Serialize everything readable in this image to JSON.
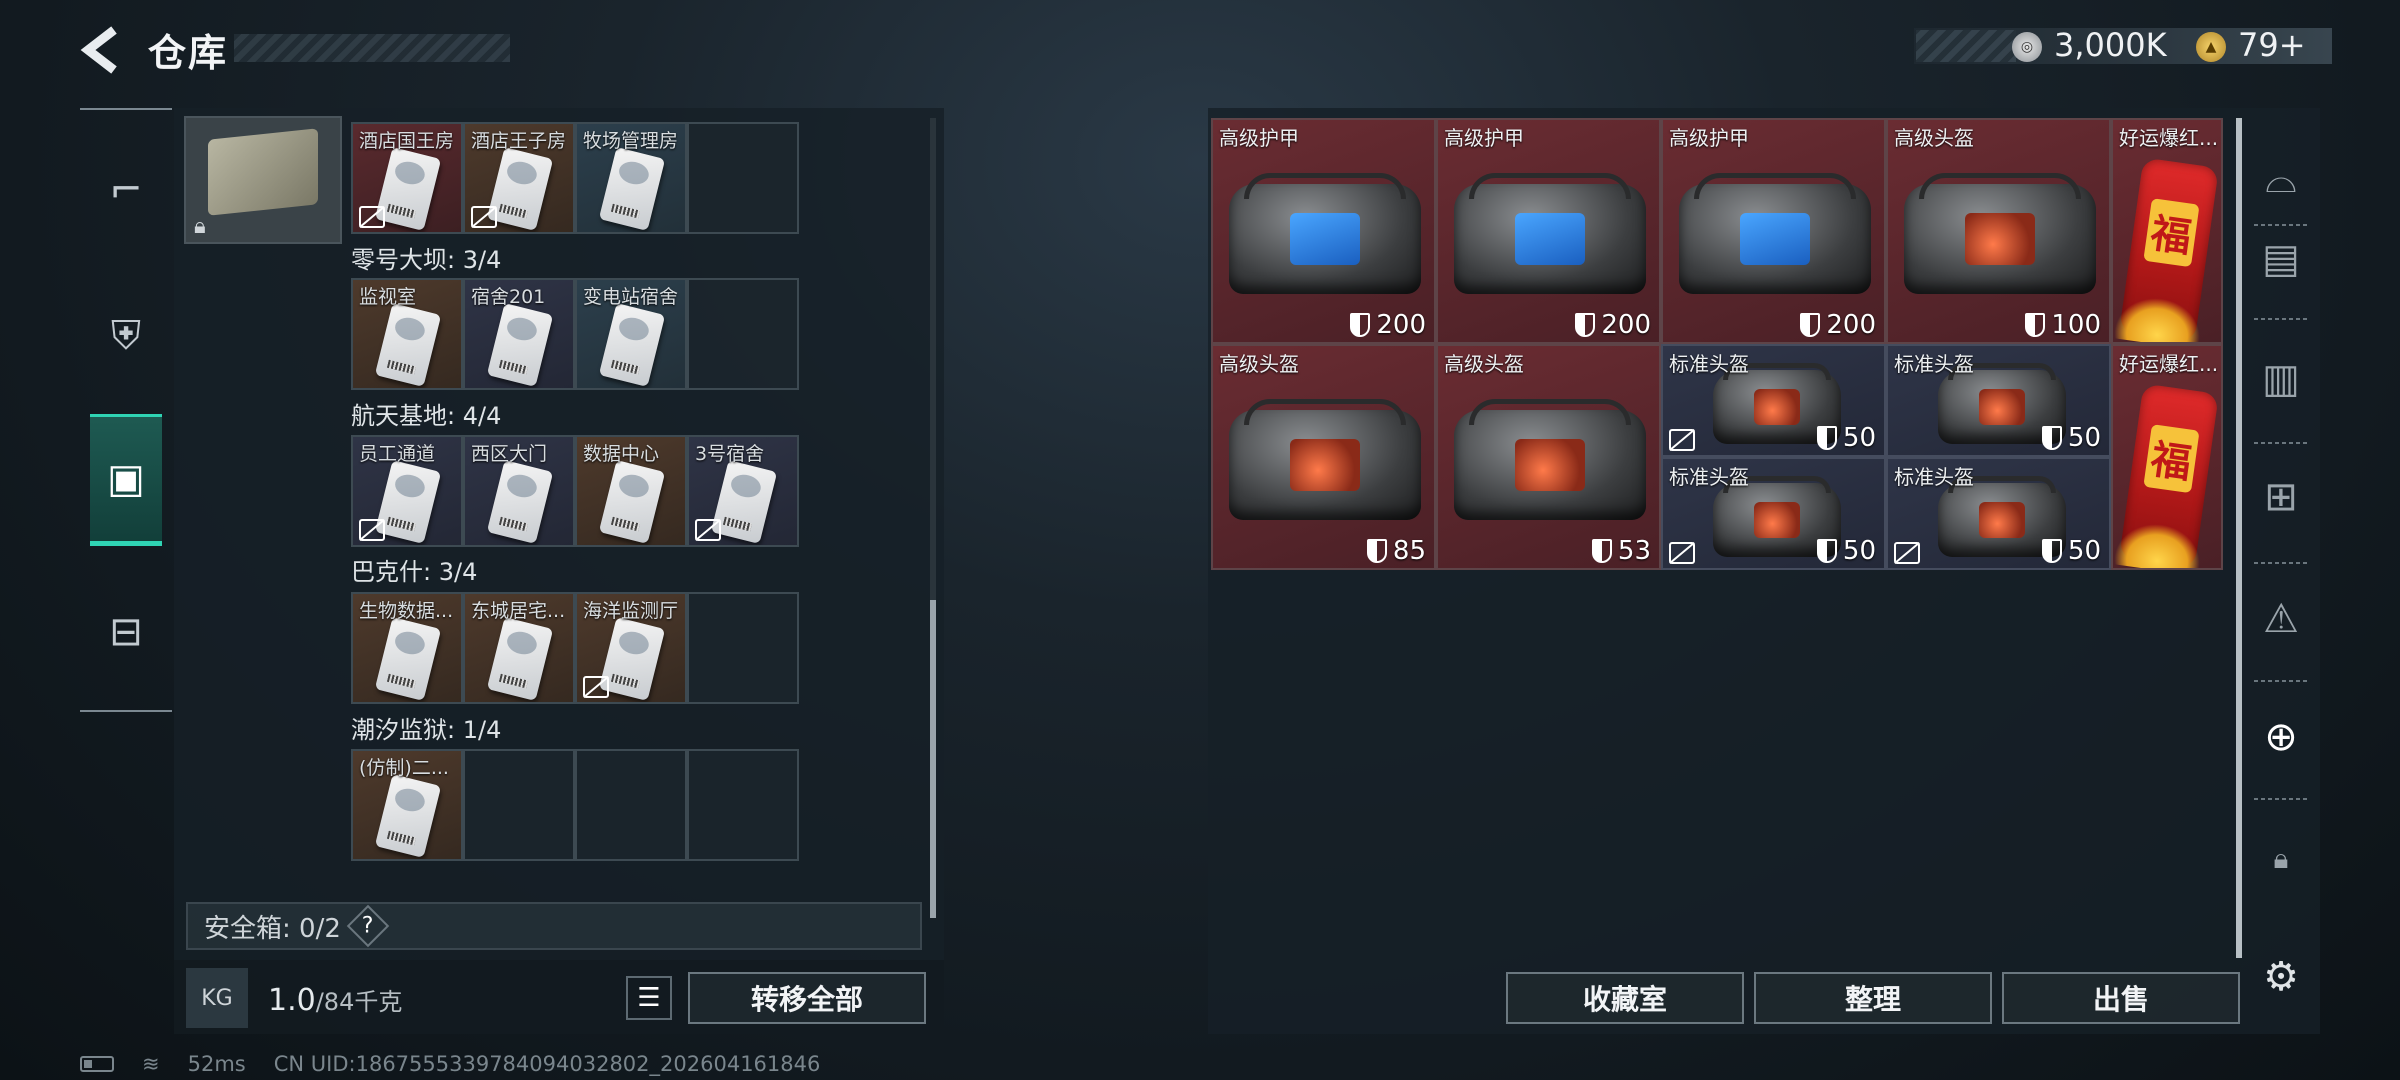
{
  "header": {
    "title": "仓库",
    "silver": "3,000K",
    "gold": "79+"
  },
  "left_tabs": [
    {
      "name": "weapons"
    },
    {
      "name": "armor"
    },
    {
      "name": "keycards",
      "active": true
    },
    {
      "name": "items"
    }
  ],
  "keycard_groups": {
    "row0": [
      {
        "label": "酒店国王房",
        "color": "red",
        "disabled": true
      },
      {
        "label": "酒店王子房",
        "color": "brown",
        "disabled": true
      },
      {
        "label": "牧场管理房",
        "color": "blue",
        "disabled": false
      },
      {
        "label": "",
        "color": "empty"
      }
    ],
    "groups": [
      {
        "title": "零号大坝: 3/4",
        "cells": [
          {
            "label": "监视室",
            "color": "brown"
          },
          {
            "label": "宿舍201",
            "color": "navy"
          },
          {
            "label": "变电站宿舍",
            "color": "blue"
          },
          {
            "label": "",
            "color": "empty"
          }
        ]
      },
      {
        "title": "航天基地: 4/4",
        "cells": [
          {
            "label": "员工通道",
            "color": "navy",
            "disabled": true
          },
          {
            "label": "西区大门",
            "color": "navy"
          },
          {
            "label": "数据中心",
            "color": "brown"
          },
          {
            "label": "3号宿舍",
            "color": "navy",
            "disabled": true
          }
        ]
      },
      {
        "title": "巴克什: 3/4",
        "cells": [
          {
            "label": "生物数据...",
            "color": "brown"
          },
          {
            "label": "东城居宅...",
            "color": "brown"
          },
          {
            "label": "海洋监测厅",
            "color": "brown",
            "disabled": true
          },
          {
            "label": "",
            "color": "empty"
          }
        ]
      },
      {
        "title": "潮汐监狱: 1/4",
        "cells": [
          {
            "label": "(仿制)二...",
            "color": "brown"
          },
          {
            "label": "",
            "color": "empty"
          },
          {
            "label": "",
            "color": "empty"
          },
          {
            "label": "",
            "color": "empty"
          }
        ]
      }
    ]
  },
  "safebox": {
    "label": "安全箱: 0/2",
    "help": "?"
  },
  "footer_left": {
    "kg_icon": "KG",
    "weight": "1.0",
    "capacity": "/84千克",
    "transfer_all": "转移全部"
  },
  "storage": [
    {
      "label": "高级护甲",
      "durability": "200",
      "color": "red",
      "kind": "bag",
      "panel": "blue"
    },
    {
      "label": "高级护甲",
      "durability": "200",
      "color": "red",
      "kind": "bag",
      "panel": "blue"
    },
    {
      "label": "高级护甲",
      "durability": "200",
      "color": "red",
      "kind": "bag",
      "panel": "blue"
    },
    {
      "label": "高级头盔",
      "durability": "100",
      "color": "red",
      "kind": "bag",
      "panel": "orange"
    },
    {
      "label": "好运爆红...",
      "durability": "",
      "color": "red",
      "kind": "fire"
    },
    {
      "label": "高级头盔",
      "durability": "85",
      "color": "red",
      "kind": "bag",
      "panel": "orange"
    },
    {
      "label": "高级头盔",
      "durability": "53",
      "color": "red",
      "kind": "bag",
      "panel": "orange"
    },
    {
      "label": "标准头盔",
      "durability": "50",
      "color": "navy",
      "kind": "small",
      "disabled": true
    },
    {
      "label": "标准头盔",
      "durability": "50",
      "color": "navy",
      "kind": "small"
    },
    {
      "label": "好运爆红...",
      "durability": "",
      "color": "red",
      "kind": "fire"
    },
    {
      "label": "标准头盔",
      "durability": "50",
      "color": "navy",
      "kind": "small",
      "disabled": true
    },
    {
      "label": "标准头盔",
      "durability": "50",
      "color": "navy",
      "kind": "small",
      "disabled": true
    }
  ],
  "footer_right": {
    "collection": "收藏室",
    "organize": "整理",
    "sell": "出售"
  },
  "status": {
    "ping": "52ms",
    "uid": "CN UID:1867555339784094032802_202604161846"
  },
  "fu_char": "福"
}
